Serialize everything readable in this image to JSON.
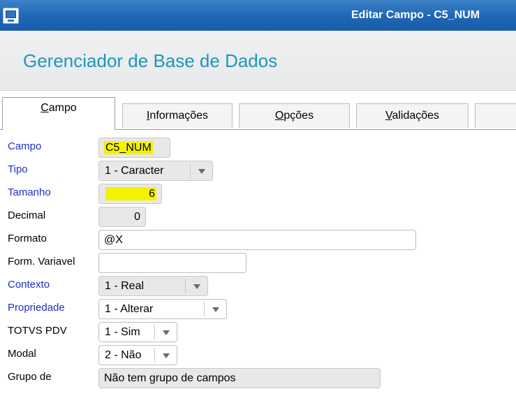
{
  "window": {
    "title": "Editar Campo - C5_NUM"
  },
  "header": {
    "app_name": "Gerenciador de Base de Dados"
  },
  "tabs": [
    {
      "prefix": "",
      "mnemonic": "C",
      "rest": "ampo",
      "active": true
    },
    {
      "prefix": "",
      "mnemonic": "I",
      "rest": "nformações",
      "active": false
    },
    {
      "prefix": "",
      "mnemonic": "O",
      "rest": "pções",
      "active": false
    },
    {
      "prefix": "",
      "mnemonic": "V",
      "rest": "alidações",
      "active": false
    }
  ],
  "form": {
    "campo": {
      "label": "Campo",
      "value": "C5_NUM"
    },
    "tipo": {
      "label": "Tipo",
      "value": "1 - Caracter"
    },
    "tamanho": {
      "label": "Tamanho",
      "value": "6"
    },
    "decimal": {
      "label": "Decimal",
      "value": "0"
    },
    "formato": {
      "label": "Formato",
      "value": "@X"
    },
    "form_variavel": {
      "label": "Form. Variavel",
      "value": ""
    },
    "contexto": {
      "label": "Contexto",
      "value": "1 - Real"
    },
    "propriedade": {
      "label": "Propriedade",
      "value": "1 - Alterar"
    },
    "totvs_pdv": {
      "label": "TOTVS PDV",
      "value": "1 - Sim"
    },
    "modal": {
      "label": "Modal",
      "value": "2 - Não"
    },
    "grupo_de": {
      "label": "Grupo de",
      "value": "Não tem grupo de campos"
    }
  },
  "colors": {
    "titlebar": "#1e66b4",
    "app_name": "#1f97b7",
    "required_label": "#1d2fc4",
    "highlight": "#f3f300"
  }
}
